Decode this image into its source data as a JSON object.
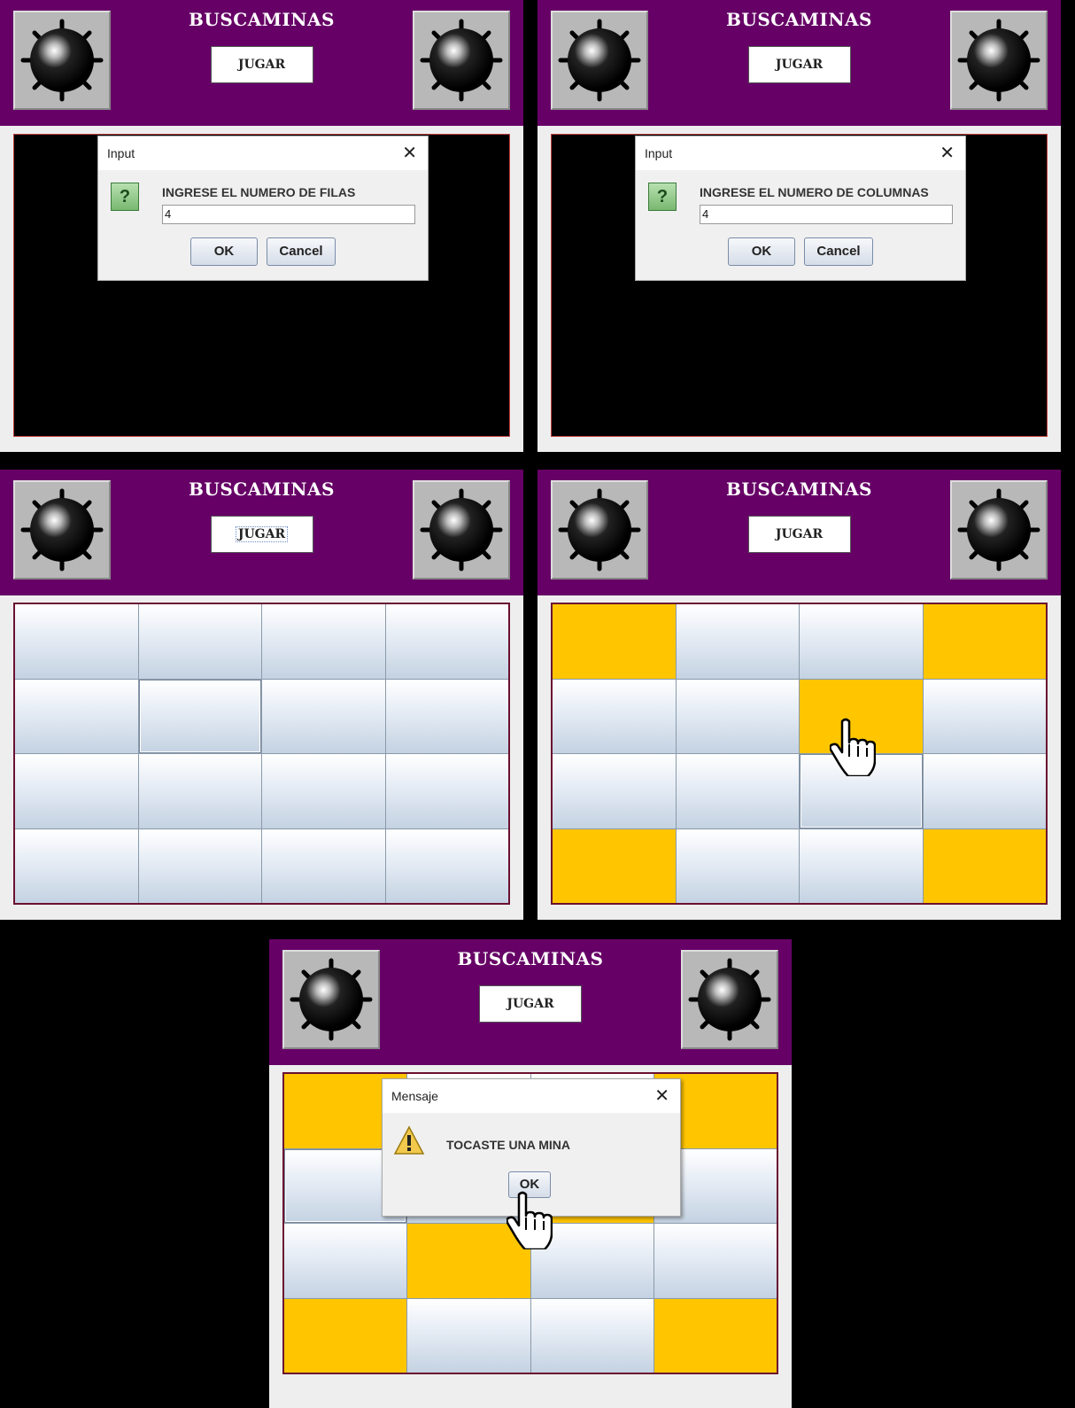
{
  "app": {
    "title": "BUSCAMINAS",
    "play_button": "JUGAR"
  },
  "colors": {
    "header": "#660066",
    "mine_cell": "#ffc600",
    "board_background": "#000000"
  },
  "dialog_rows": {
    "title": "Input",
    "close": "✕",
    "message": "INGRESE EL NUMERO DE FILAS",
    "value": "4",
    "ok": "OK",
    "cancel": "Cancel",
    "icon": "question-icon"
  },
  "dialog_cols": {
    "title": "Input",
    "close": "✕",
    "message": "INGRESE EL NUMERO DE COLUMNAS",
    "value": "4",
    "ok": "OK",
    "cancel": "Cancel",
    "icon": "question-icon"
  },
  "dialog_mine": {
    "title": "Mensaje",
    "close": "✕",
    "message": "TOCASTE UNA MINA",
    "ok": "OK",
    "icon": "warning-icon"
  },
  "boards": {
    "rows": 4,
    "columns": 4,
    "board3_mines": [],
    "board4_mines": [
      [
        0,
        0
      ],
      [
        0,
        3
      ],
      [
        1,
        2
      ],
      [
        3,
        0
      ],
      [
        3,
        3
      ]
    ],
    "board5_mines": [
      [
        0,
        0
      ],
      [
        0,
        3
      ],
      [
        1,
        2
      ],
      [
        2,
        1
      ],
      [
        3,
        0
      ],
      [
        3,
        3
      ]
    ]
  }
}
